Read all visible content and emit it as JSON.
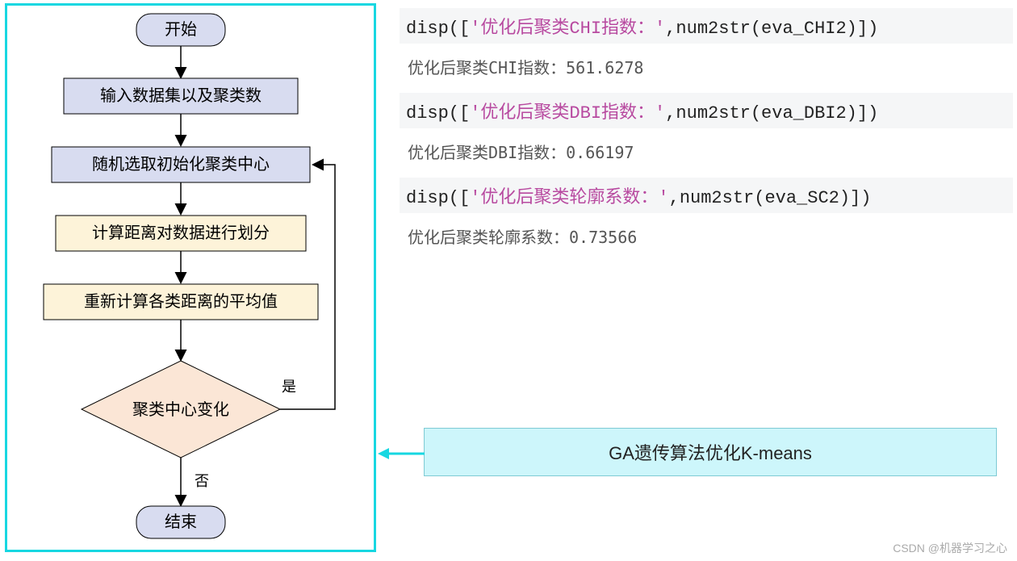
{
  "flowchart": {
    "start": "开始",
    "step1": "输入数据集以及聚类数",
    "step2": "随机选取初始化聚类中心",
    "step3": "计算距离对数据进行划分",
    "step4": "重新计算各类距离的平均值",
    "decision": "聚类中心变化",
    "yes_label": "是",
    "no_label": "否",
    "end": "结束"
  },
  "code": {
    "line1_pre": "disp([",
    "line1_str": "'优化后聚类CHI指数：'",
    "line1_mid": ",num2str(eva_CHI2)])",
    "out1": "优化后聚类CHI指数：561.6278",
    "line2_pre": "disp([",
    "line2_str": "'优化后聚类DBI指数：'",
    "line2_mid": ",num2str(eva_DBI2)])",
    "out2": "优化后聚类DBI指数：0.66197",
    "line3_pre": "disp([",
    "line3_str": "'优化后聚类轮廓系数：'",
    "line3_mid": ",num2str(eva_SC2)])",
    "out3": "优化后聚类轮廓系数：0.73566"
  },
  "callout": "GA遗传算法优化K-means",
  "watermark": "CSDN @机器学习之心",
  "chart_data": {
    "type": "table",
    "title": "GA遗传算法优化K-means 聚类评价指标输出",
    "series": [
      {
        "name": "优化后聚类CHI指数",
        "values": [
          561.6278
        ]
      },
      {
        "name": "优化后聚类DBI指数",
        "values": [
          0.66197
        ]
      },
      {
        "name": "优化后聚类轮廓系数",
        "values": [
          0.73566
        ]
      }
    ],
    "flow_steps": [
      "开始",
      "输入数据集以及聚类数",
      "随机选取初始化聚类中心",
      "计算距离对数据进行划分",
      "重新计算各类距离的平均值",
      "聚类中心变化 (是→回到步骤 随机选取初始化聚类中心, 否→结束)",
      "结束"
    ]
  }
}
